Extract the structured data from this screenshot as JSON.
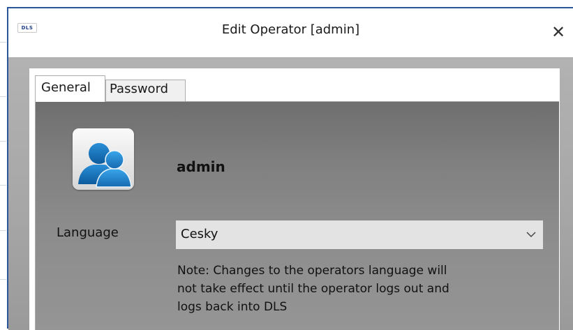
{
  "window": {
    "app_icon_text": "DLS",
    "title": "Edit Operator [admin]",
    "close_glyph": "✕"
  },
  "tabs": [
    {
      "label": "General",
      "selected": true
    },
    {
      "label": "Password",
      "selected": false
    }
  ],
  "general": {
    "avatar_icon": "user-group-icon",
    "username": "admin",
    "language_label": "Language",
    "language_value": "Cesky",
    "language_dropdown_icon": "chevron-down-icon",
    "note_lines": [
      "Note:  Changes to the operators language will",
      "not take effect until the operator logs out and",
      "logs back into DLS"
    ]
  },
  "colors": {
    "window_border": "#2b579a",
    "avatar_blue": "#1f7ac7"
  }
}
